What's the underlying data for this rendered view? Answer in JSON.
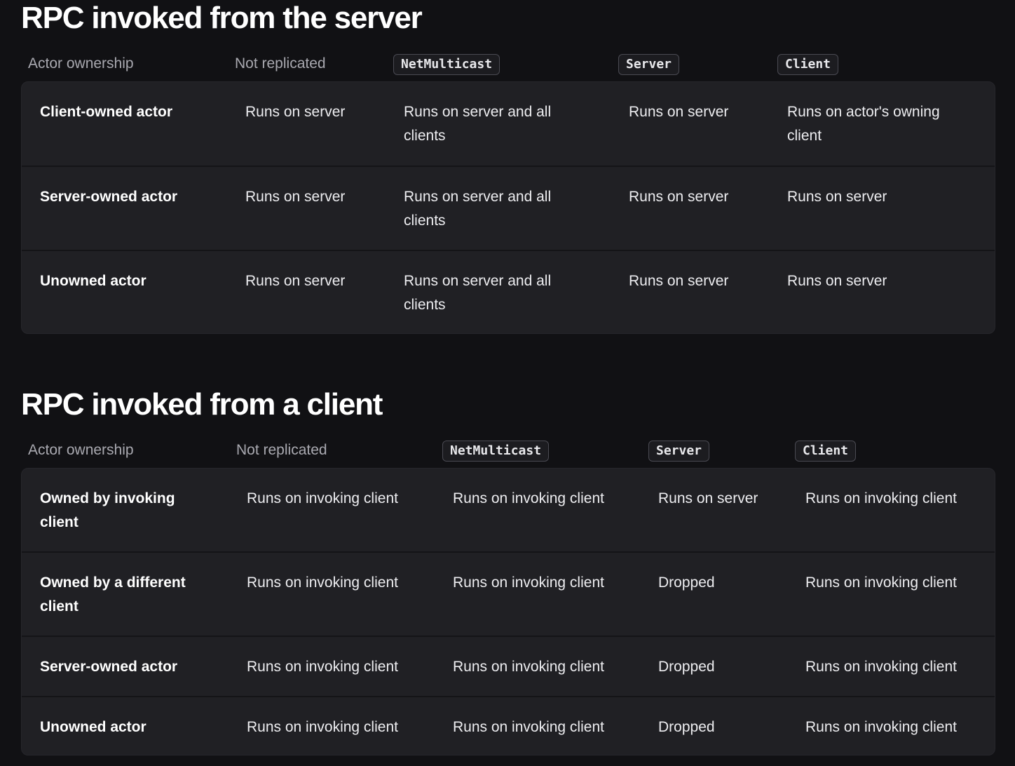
{
  "server_section": {
    "title": "RPC invoked from the server",
    "headers": {
      "ownership": "Actor ownership",
      "not_replicated": "Not replicated",
      "multicast": "NetMulticast",
      "server": "Server",
      "client": "Client"
    },
    "rows": [
      {
        "label": "Client-owned actor",
        "not_replicated": "Runs on server",
        "multicast": "Runs on server and all clients",
        "server": "Runs on server",
        "client": "Runs on actor's owning client"
      },
      {
        "label": "Server-owned actor",
        "not_replicated": "Runs on server",
        "multicast": "Runs on server and all clients",
        "server": "Runs on server",
        "client": "Runs on server"
      },
      {
        "label": "Unowned actor",
        "not_replicated": "Runs on server",
        "multicast": "Runs on server and all clients",
        "server": "Runs on server",
        "client": "Runs on server"
      }
    ]
  },
  "client_section": {
    "title": "RPC invoked from a client",
    "headers": {
      "ownership": "Actor ownership",
      "not_replicated": "Not replicated",
      "multicast": "NetMulticast",
      "server": "Server",
      "client": "Client"
    },
    "rows": [
      {
        "label": "Owned by invoking client",
        "not_replicated": "Runs on invoking client",
        "multicast": "Runs on invoking client",
        "server": "Runs on server",
        "client": "Runs on invoking client"
      },
      {
        "label": "Owned by a different client",
        "not_replicated": "Runs on invoking client",
        "multicast": "Runs on invoking client",
        "server": "Dropped",
        "client": "Runs on invoking client"
      },
      {
        "label": "Server-owned actor",
        "not_replicated": "Runs on invoking client",
        "multicast": "Runs on invoking client",
        "server": "Dropped",
        "client": "Runs on invoking client"
      },
      {
        "label": "Unowned actor",
        "not_replicated": "Runs on invoking client",
        "multicast": "Runs on invoking client",
        "server": "Dropped",
        "client": "Runs on invoking client"
      }
    ]
  }
}
